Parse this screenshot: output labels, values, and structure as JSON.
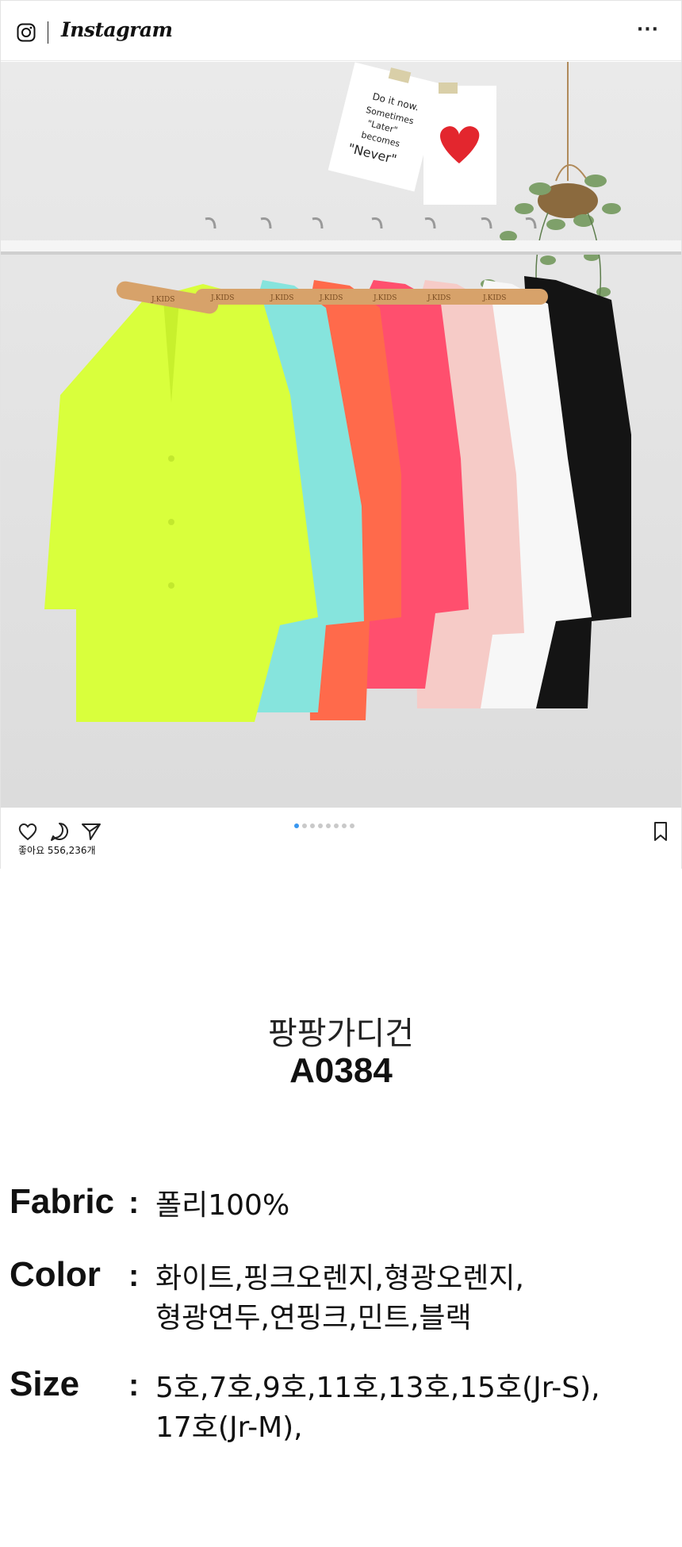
{
  "header": {
    "app_name": "Instagram",
    "logo_icon": "instagram-camera-icon",
    "more_label": "···"
  },
  "photo": {
    "note_text": [
      "Do it now.",
      "Sometimes",
      "\"Later\"",
      "becomes",
      "\"Never\""
    ],
    "hanger_brand": "J.KIDS",
    "cardigan_colors": [
      "#d9ff3c",
      "#7fe3dc",
      "#ff6a4b",
      "#ff4f6e",
      "#f5c9c6",
      "#ffffff",
      "#111111"
    ]
  },
  "actions": {
    "icons": [
      "heart-icon",
      "comment-icon",
      "share-icon",
      "bookmark-icon"
    ],
    "likes_text": "좋아요 556,236개",
    "carousel_count": 8,
    "carousel_active": 0
  },
  "product": {
    "name": "팡팡가디건",
    "code": "A0384"
  },
  "specs": {
    "fabric_label": "Fabric",
    "fabric_value": "폴리100%",
    "color_label": "Color",
    "color_value": "화이트,핑크오렌지,형광오렌지,\n형광연두,연핑크,민트,블랙",
    "size_label": "Size",
    "size_value": "5호,7호,9호,11호,13호,15호(Jr-S),\n17호(Jr-M),",
    "colon": ":"
  }
}
